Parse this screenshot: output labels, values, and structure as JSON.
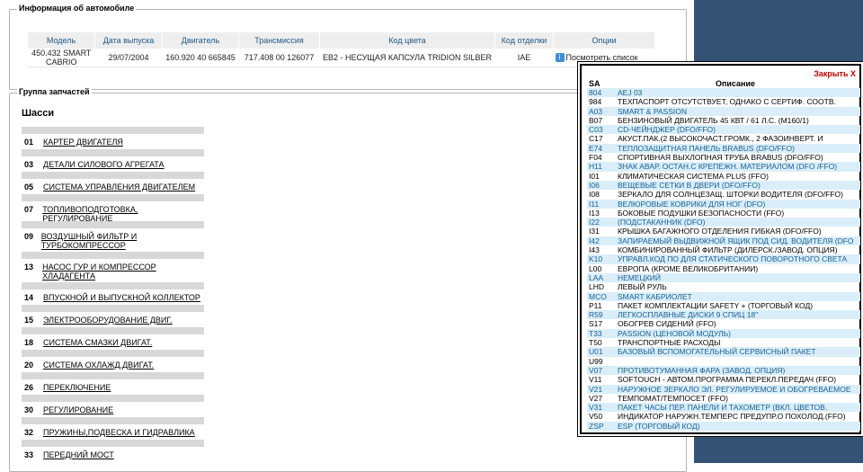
{
  "car_info": {
    "legend": "Информация об автомобиле",
    "headers": [
      "Модель",
      "Дата выпуска",
      "Двигатель",
      "Трансмиссия",
      "Код цвета",
      "Код отделки",
      "Опции"
    ],
    "row": {
      "model": "450.432  SMART CABRIO",
      "date": "29/07/2004",
      "engine": "160.920 40 665845",
      "transmission": "717.408 00 126077",
      "color": "EB2 - НЕСУЩАЯ КАПСУЛА TRIDION SILBER",
      "trim": "IAE",
      "options_link": "Посмотреть список"
    }
  },
  "groups": {
    "legend": "Группа запчастей",
    "heading": "Шасси",
    "items": [
      {
        "num": "01",
        "label": "КАРТЕР ДВИГАТЕЛЯ"
      },
      {
        "num": "03",
        "label": "ДЕТАЛИ СИЛОВОГО АГРЕГАТА"
      },
      {
        "num": "05",
        "label": "СИСТЕМА УПРАВЛЕНИЯ ДВИГАТЕЛЕМ"
      },
      {
        "num": "07",
        "label": "ТОПЛИВОПОДГОТОВКА, РЕГУЛИРОВАНИЕ"
      },
      {
        "num": "09",
        "label": "ВОЗДУШНЫЙ ФИЛЬТР И ТУРБОКОМПРЕССОР"
      },
      {
        "num": "13",
        "label": "НАСОС ГУР И КОМПРЕССОР ХЛАДАГЕНТА"
      },
      {
        "num": "14",
        "label": "ВПУСКНОЙ И ВЫПУСКНОЙ КОЛЛЕКТОР"
      },
      {
        "num": "15",
        "label": "ЭЛЕКТРООБОРУДОВАНИЕ ДВИГ."
      },
      {
        "num": "18",
        "label": "СИСТЕМА СМАЗКИ ДВИГАТ."
      },
      {
        "num": "20",
        "label": "СИСТЕМА ОХЛАЖД.ДВИГАТ."
      },
      {
        "num": "26",
        "label": "ПЕРЕКЛЮЧЕНИЕ"
      },
      {
        "num": "30",
        "label": "РЕГУЛИРОВАНИЕ"
      },
      {
        "num": "32",
        "label": "ПРУЖИНЫ,ПОДВЕСКА И ГИДРАВЛИКА"
      },
      {
        "num": "33",
        "label": "ПЕРЕДНИЙ МОСТ"
      }
    ]
  },
  "popup": {
    "close_label": "Закрыть X",
    "col_code": "SA код",
    "col_desc": "Описание",
    "rows": [
      {
        "code": "804",
        "desc": "AEJ 03",
        "hl": true
      },
      {
        "code": "984",
        "desc": "ТЕХПАСПОРТ ОТСУТСТВУЕТ, ОДНАКО С СЕРТИФ. СООТВ.",
        "hl": false
      },
      {
        "code": "A03",
        "desc": "SMART & PASSION",
        "hl": true
      },
      {
        "code": "B07",
        "desc": "БЕНЗИНОВЫЙ ДВИГАТЕЛЬ 45 КВТ / 61 Л.С. (M160/1)",
        "hl": false
      },
      {
        "code": "C03",
        "desc": "CD-ЧЕЙНДЖЕР (DFO/FFO)",
        "hl": true
      },
      {
        "code": "C17",
        "desc": "АКУСТ.ПАК.(2 ВЫСОКОЧАСТ.ГРОМК., 2 ФАЗОИНВЕРТ. И",
        "hl": false
      },
      {
        "code": "E74",
        "desc": "ТЕПЛОЗАЩИТНАЯ ПАНЕЛЬ BRABUS (DFO/FFO)",
        "hl": true
      },
      {
        "code": "F04",
        "desc": "СПОРТИВНАЯ ВЫХЛОПНАЯ ТРУБА BRABUS (DFO/FFO)",
        "hl": false
      },
      {
        "code": "H11",
        "desc": "ЗНАК АВАР. ОСТАН.С КРЕПЕЖН. МАТЕРИАЛОМ (DFO /FFO)",
        "hl": true
      },
      {
        "code": "I01",
        "desc": "КЛИМАТИЧЕСКАЯ СИСТЕМА PLUS (FFO)",
        "hl": false
      },
      {
        "code": "I06",
        "desc": "ВЕЩЕВЫЕ СЕТКИ В ДВЕРИ (DFO/FFO)",
        "hl": true
      },
      {
        "code": "I08",
        "desc": "ЗЕРКАЛО ДЛЯ СОЛНЦЕЗАЩ. ШТОРКИ ВОДИТЕЛЯ (DFO/FFO)",
        "hl": false
      },
      {
        "code": "I11",
        "desc": "ВЕЛЮРОВЫЕ КОВРИКИ ДЛЯ НОГ (DFO)",
        "hl": true
      },
      {
        "code": "I13",
        "desc": "БОКОВЫЕ ПОДУШКИ БЕЗОПАСНОСТИ (FFO)",
        "hl": false
      },
      {
        "code": "I22",
        "desc": "(ПОДСТАКАННИК (DFO)",
        "hl": true
      },
      {
        "code": "I31",
        "desc": "КРЫШКА БАГАЖНОГО ОТДЕЛЕНИЯ ГИБКАЯ (DFO/FFO)",
        "hl": false
      },
      {
        "code": "I42",
        "desc": "ЗАПИРАЕМЫЙ ВЫДВИЖНОЙ ЯЩИК ПОД СИД. ВОДИТЕЛЯ (DFO",
        "hl": true
      },
      {
        "code": "I43",
        "desc": "КОМБИНИРОВАННЫЙ ФИЛЬТР (ДИЛЕРСК./ЗАВОД. ОПЦИЯ)",
        "hl": false
      },
      {
        "code": "K10",
        "desc": "УПРАВЛ.КОД ПО ДЛЯ СТАТИЧЕСКОГО ПОВОРОТНОГО СВЕТА",
        "hl": true
      },
      {
        "code": "L00",
        "desc": "ЕВРОПА (КРОМЕ ВЕЛИКОБРИТАНИИ)",
        "hl": false
      },
      {
        "code": "LAA",
        "desc": "НЕМЕЦКИЙ",
        "hl": true
      },
      {
        "code": "LHD",
        "desc": "ЛЕВЫЙ РУЛЬ",
        "hl": false
      },
      {
        "code": "MCO",
        "desc": "SMART КАБРИОЛЕТ",
        "hl": true
      },
      {
        "code": "P11",
        "desc": "ПАКЕТ КОМПЛЕКТАЦИИ SAFETY + (ТОРГОВЫЙ КОД)",
        "hl": false
      },
      {
        "code": "R59",
        "desc": "ЛЕГКОСПЛАВНЫЕ ДИСКИ 9 СПИЦ 18\"",
        "hl": true
      },
      {
        "code": "S17",
        "desc": "ОБОГРЕВ СИДЕНИЙ (FFO)",
        "hl": false
      },
      {
        "code": "T33",
        "desc": "PASSION (ЦЕНОВОЙ МОДУЛЬ)",
        "hl": true
      },
      {
        "code": "T50",
        "desc": "ТРАНСПОРТНЫЕ РАСХОДЫ",
        "hl": false
      },
      {
        "code": "U01",
        "desc": "БАЗОВЫЙ ВСПОМОГАТЕЛЬНЫЙ СЕРВИСНЫЙ ПАКЕТ",
        "hl": true
      },
      {
        "code": "U99",
        "desc": "",
        "hl": false
      },
      {
        "code": "V07",
        "desc": "ПРОТИВОТУМАННАЯ ФАРА (ЗАВОД. ОПЦИЯ)",
        "hl": true
      },
      {
        "code": "V11",
        "desc": "SOFTOUCH - АВТОМ.ПРОГРАММА ПЕРЕКЛ.ПЕРЕДАЧ (FFO)",
        "hl": false
      },
      {
        "code": "V21",
        "desc": "НАРУЖНОЕ ЗЕРКАЛО ЭЛ. РЕГУЛИРУЕМОЕ И ОБОГРЕВАЕМОЕ",
        "hl": true
      },
      {
        "code": "V27",
        "desc": "ТЕМПОМАТ/ТЕМПОСЕТ (FFO)",
        "hl": false
      },
      {
        "code": "V31",
        "desc": "ПАКЕТ ЧАСЫ ПЕР. ПАНЕЛИ И ТАХОМЕТР (ВКЛ. ЦВЕТОВ.",
        "hl": true
      },
      {
        "code": "V50",
        "desc": "ИНДИКАТОР НАРУЖН.ТЕМПЕРС ПРЕДУПР.О ПОХОЛОД.(FFO)",
        "hl": false
      },
      {
        "code": "ZSP",
        "desc": "ESP (ТОРГОВЫЙ КОД)",
        "hl": true
      }
    ]
  }
}
